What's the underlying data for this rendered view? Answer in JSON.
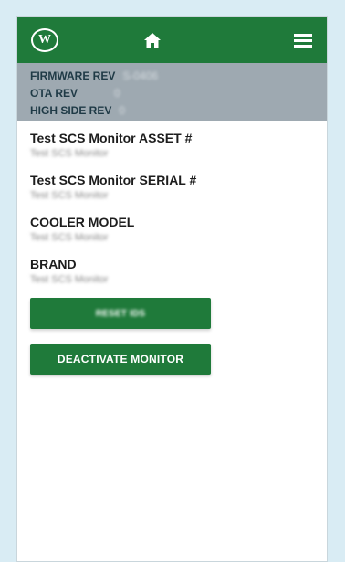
{
  "header": {
    "logo_glyph": "W",
    "home_icon": "home-icon",
    "menu_icon": "hamburger-menu-icon",
    "background_color": "#1f7a3a"
  },
  "revisions": [
    {
      "label": "FIRMWARE REV",
      "value": "S-0406"
    },
    {
      "label": "OTA REV",
      "value": "0"
    },
    {
      "label": "HIGH SIDE REV",
      "value": "0"
    }
  ],
  "fields": [
    {
      "label": "Test SCS Monitor ASSET #",
      "value": "Test SCS Monitor"
    },
    {
      "label": "Test SCS Monitor SERIAL #",
      "value": "Test SCS Monitor"
    },
    {
      "label": "COOLER MODEL",
      "value": "Test SCS Monitor"
    },
    {
      "label": "BRAND",
      "value": "Test SCS Monitor"
    }
  ],
  "buttons": {
    "reset_label": "RESET IDS",
    "deactivate_label": "DEACTIVATE MONITOR"
  }
}
